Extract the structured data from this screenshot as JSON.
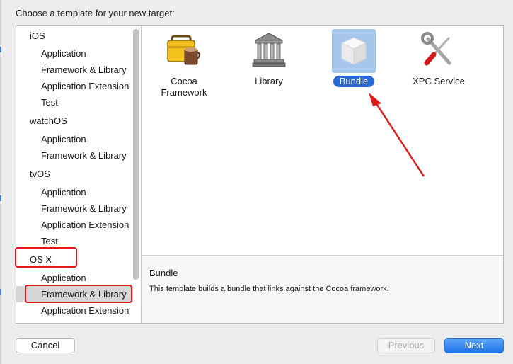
{
  "dialog": {
    "prompt": "Choose a template for your new target:"
  },
  "sidebar": {
    "rows": [
      {
        "kind": "category",
        "label": "iOS"
      },
      {
        "kind": "item",
        "label": "Application"
      },
      {
        "kind": "item",
        "label": "Framework & Library"
      },
      {
        "kind": "item",
        "label": "Application Extension"
      },
      {
        "kind": "item",
        "label": "Test"
      },
      {
        "kind": "category",
        "label": "watchOS"
      },
      {
        "kind": "item",
        "label": "Application"
      },
      {
        "kind": "item",
        "label": "Framework & Library"
      },
      {
        "kind": "category",
        "label": "tvOS"
      },
      {
        "kind": "item",
        "label": "Application"
      },
      {
        "kind": "item",
        "label": "Framework & Library"
      },
      {
        "kind": "item",
        "label": "Application Extension"
      },
      {
        "kind": "item",
        "label": "Test"
      },
      {
        "kind": "category",
        "label": "OS X"
      },
      {
        "kind": "item",
        "label": "Application"
      },
      {
        "kind": "item",
        "label": "Framework & Library",
        "selected": true
      },
      {
        "kind": "item",
        "label": "Application Extension"
      }
    ]
  },
  "templates": [
    {
      "label": "Cocoa\nFramework",
      "icon": "toolbox-icon"
    },
    {
      "label": "Library",
      "icon": "library-building-icon"
    },
    {
      "label": "Bundle",
      "icon": "bundle-box-icon",
      "selected": true
    },
    {
      "label": "XPC Service",
      "icon": "wrench-screwdriver-icon"
    }
  ],
  "description": {
    "title": "Bundle",
    "text": "This template builds a bundle that links against the Cocoa framework."
  },
  "buttons": {
    "cancel": "Cancel",
    "previous": "Previous",
    "next": "Next"
  },
  "colors": {
    "selection_blue": "#2a68d6",
    "annotation_red": "#e0191b"
  }
}
